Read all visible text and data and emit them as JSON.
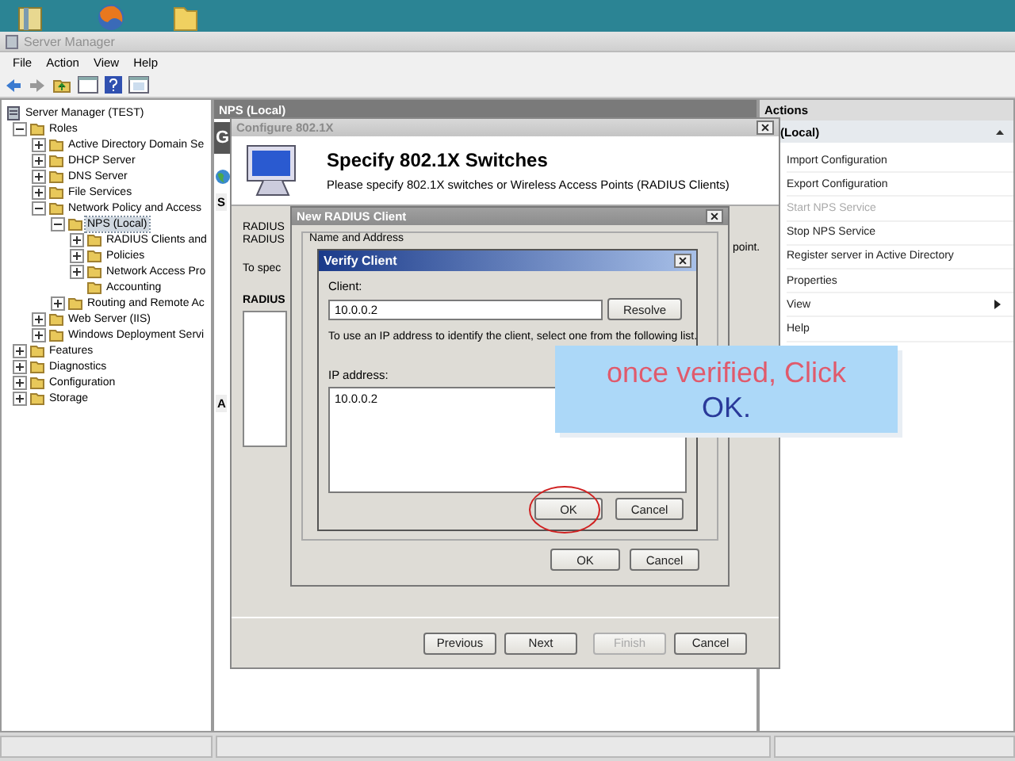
{
  "window": {
    "title": "Server Manager"
  },
  "menu": [
    "File",
    "Action",
    "View",
    "Help"
  ],
  "tree": [
    {
      "label": "Server Manager (TEST)",
      "selected": false,
      "children": [
        {
          "label": "Roles",
          "expanded": true,
          "selected": false,
          "children": [
            {
              "label": "Active Directory Domain Se",
              "expanded": false,
              "selected": false
            },
            {
              "label": "DHCP Server",
              "expanded": false,
              "selected": false
            },
            {
              "label": "DNS Server",
              "expanded": false,
              "selected": false
            },
            {
              "label": "File Services",
              "expanded": false,
              "selected": false
            },
            {
              "label": "Network Policy and Access",
              "expanded": true,
              "selected": false,
              "children": [
                {
                  "label": "NPS (Local)",
                  "expanded": true,
                  "selected": true,
                  "children": [
                    {
                      "label": "RADIUS Clients and",
                      "expanded": false,
                      "selected": false
                    },
                    {
                      "label": "Policies",
                      "expanded": false,
                      "selected": false
                    },
                    {
                      "label": "Network Access Pro",
                      "expanded": false,
                      "selected": false
                    },
                    {
                      "label": "Accounting",
                      "selected": false
                    }
                  ]
                },
                {
                  "label": "Routing and Remote Ac",
                  "expanded": false,
                  "selected": false
                }
              ]
            },
            {
              "label": "Web Server (IIS)",
              "expanded": false,
              "selected": false
            },
            {
              "label": "Windows Deployment Servi",
              "expanded": false,
              "selected": false
            }
          ]
        },
        {
          "label": "Features",
          "expanded": false,
          "selected": false
        },
        {
          "label": "Diagnostics",
          "expanded": false,
          "selected": false
        },
        {
          "label": "Configuration",
          "expanded": false,
          "selected": false
        },
        {
          "label": "Storage",
          "expanded": false,
          "selected": false
        }
      ]
    }
  ],
  "center_pane": {
    "header": "NPS (Local)",
    "banner": "G",
    "tab": "S",
    "section": "A"
  },
  "actions": {
    "title": "Actions",
    "section": "(Local)",
    "items": [
      {
        "label": "Import Configuration",
        "disabled": false,
        "submenu": false
      },
      {
        "label": "Export Configuration",
        "disabled": false,
        "submenu": false
      },
      {
        "label": "Start NPS Service",
        "disabled": true,
        "submenu": false
      },
      {
        "label": "Stop NPS Service",
        "disabled": false,
        "submenu": false
      },
      {
        "label": "Register server in Active Directory",
        "disabled": false,
        "submenu": false
      },
      {
        "label": "Properties",
        "disabled": false,
        "submenu": false
      },
      {
        "label": "View",
        "disabled": false,
        "submenu": true
      },
      {
        "label": "Help",
        "disabled": false,
        "submenu": false
      }
    ]
  },
  "configure_dialog": {
    "title": "Configure 802.1X",
    "heading": "Specify 802.1X Switches",
    "subheading": "Please specify 802.1X switches or Wireless Access Points (RADIUS Clients)",
    "body_lines": [
      "RADIUS",
      "RADIUS",
      "To spec"
    ],
    "list_heading": "RADIUS",
    "side_text": "point.",
    "buttons": [
      {
        "label": "Previous",
        "disabled": false
      },
      {
        "label": "Next",
        "disabled": false
      },
      {
        "label": "Finish",
        "disabled": true
      },
      {
        "label": "Cancel",
        "disabled": false
      }
    ]
  },
  "radius_dialog": {
    "title": "New RADIUS Client",
    "group": "Name and Address",
    "buttons": [
      "OK",
      "Cancel"
    ]
  },
  "verify_dialog": {
    "title": "Verify Client",
    "client_label": "Client:",
    "client_value": "10.0.0.2",
    "resolve": "Resolve",
    "instruction": "To use an IP address to identify the client, select one from the following list.",
    "list_label": "IP address:",
    "addresses": [
      "10.0.0.2"
    ],
    "buttons": [
      "OK",
      "Cancel"
    ]
  },
  "callout": {
    "line_1": "once verified, Click",
    "line_2": "OK."
  }
}
